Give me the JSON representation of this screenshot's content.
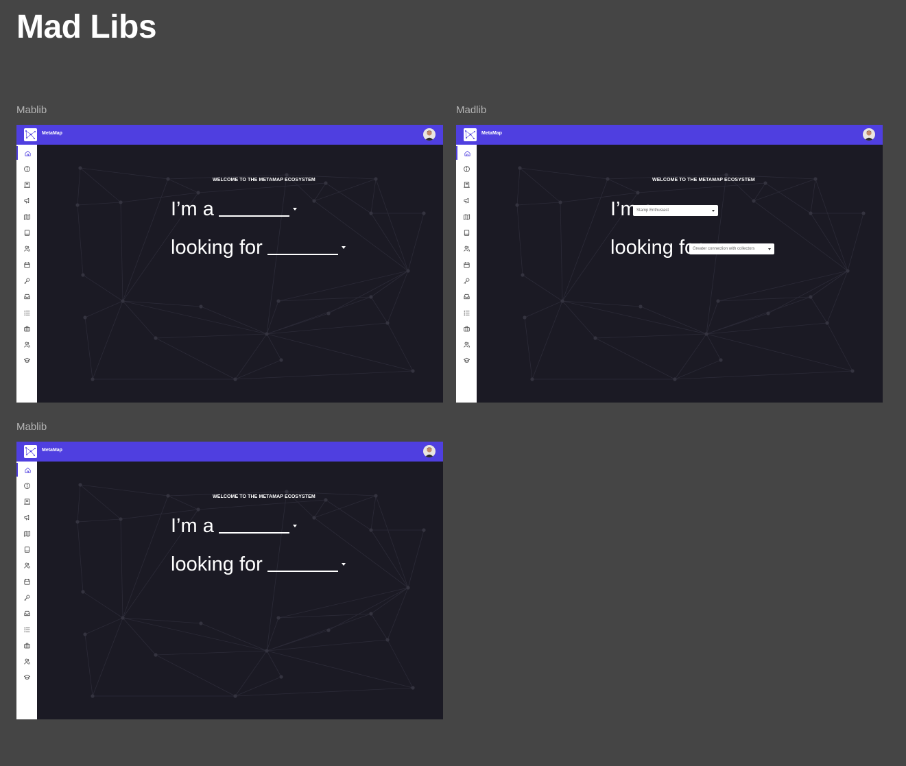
{
  "page_title": "Mad Libs",
  "frames": [
    {
      "label": "Mablib",
      "app_name": "MetaMap",
      "welcome": "WELCOME TO THE METAMAP ECOSYSTEM",
      "line1": "I’m a",
      "line2": "looking for"
    },
    {
      "label": "Madlib",
      "app_name": "MetaMap",
      "welcome": "WELCOME TO THE METAMAP ECOSYSTEM",
      "line1": "I’m a",
      "line2": "looking for",
      "select1_value": "Stamp Enthusiast",
      "select2_value": "Greater connection with collectors"
    },
    {
      "label": "Mablib",
      "app_name": "MetaMap",
      "welcome": "WELCOME TO THE METAMAP ECOSYSTEM",
      "line1": "I’m a",
      "line2": "looking for"
    }
  ],
  "sidebar_icons": [
    "home-icon",
    "info-icon",
    "building-icon",
    "megaphone-icon",
    "map-icon",
    "book-icon",
    "users-icon",
    "calendar-icon",
    "key-icon",
    "inbox-icon",
    "list-icon",
    "briefcase-icon",
    "user-group-icon",
    "graduation-cap-icon"
  ],
  "colors": {
    "canvas": "#454545",
    "topbar": "#4f3fe0",
    "main_bg": "#1b1a24",
    "sidebar_bg": "#ffffff"
  }
}
